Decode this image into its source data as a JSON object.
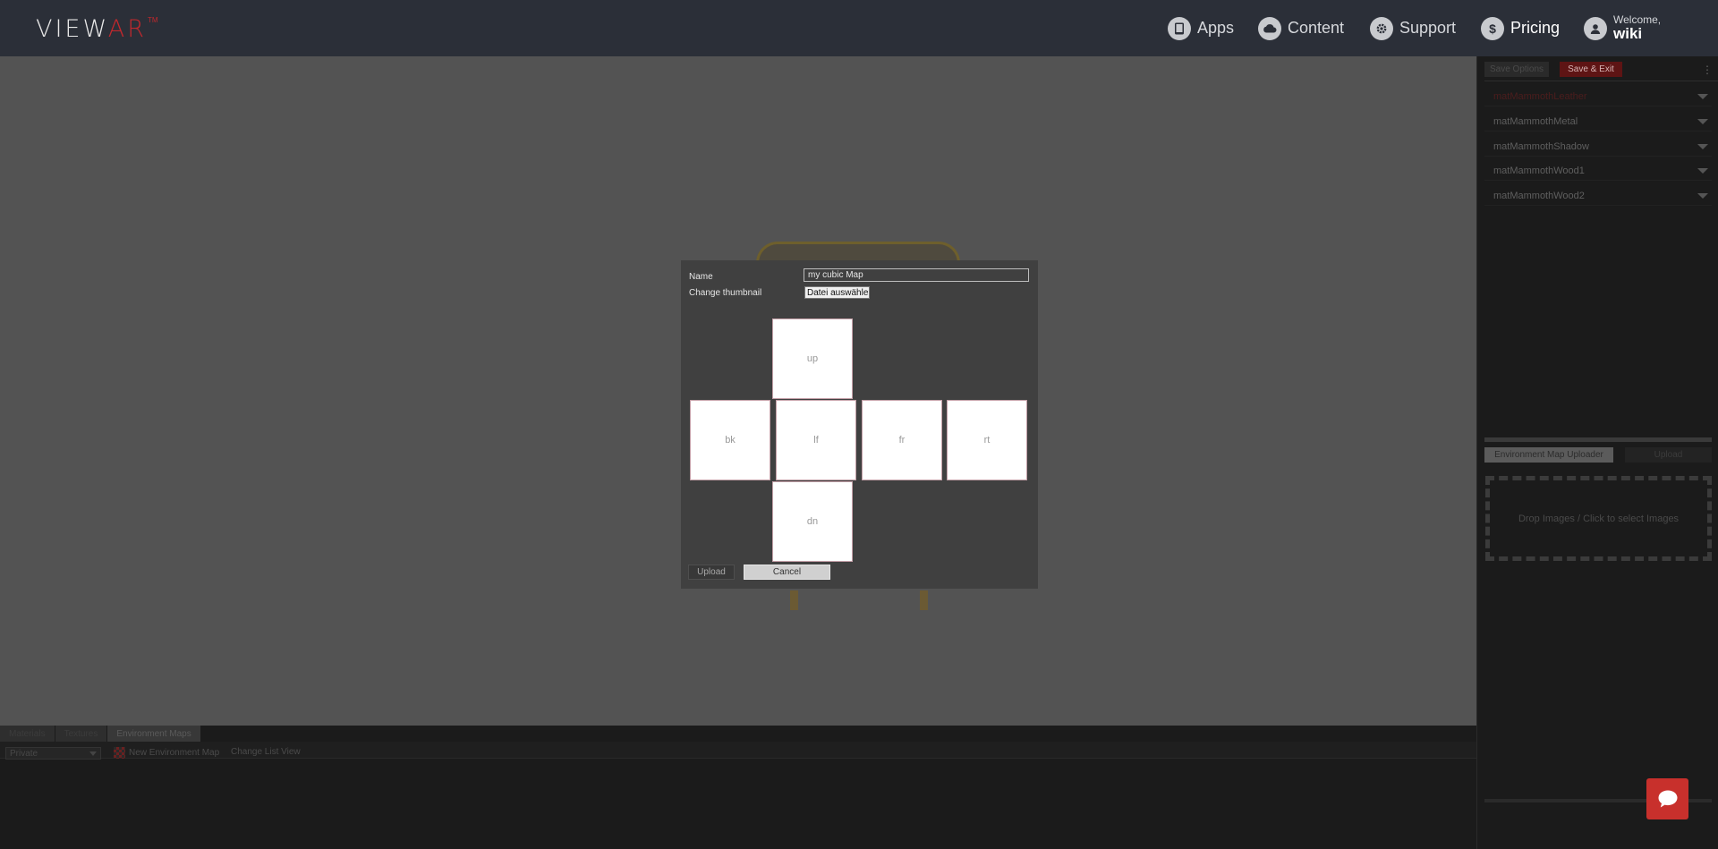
{
  "brand": {
    "logo_part1": "VIEW",
    "logo_part2": "AR",
    "logo_tm": "TM"
  },
  "nav": {
    "apps": "Apps",
    "content": "Content",
    "support": "Support",
    "pricing": "Pricing",
    "pricing_icon": "$",
    "welcome": "Welcome,",
    "user": "wiki"
  },
  "right_panel": {
    "save_options": "Save Options",
    "save_exit": "Save & Exit",
    "more": "⋮",
    "materials": [
      "matMammothLeather",
      "matMammothMetal",
      "matMammothShadow",
      "matMammothWood1",
      "matMammothWood2"
    ],
    "env_uploader_tab": "Environment Map Uploader",
    "upload_tab": "Upload",
    "dropzone": "Drop Images / Click to select Images"
  },
  "bottom_panel": {
    "tabs": [
      "Materials",
      "Textures",
      "Environment Maps"
    ],
    "visibility_select": "Private",
    "new_env_map": "New Environment Map",
    "change_list_view": "Change List View"
  },
  "modal": {
    "name_label": "Name",
    "name_value": "my cubic Map",
    "thumbnail_label": "Change thumbnail",
    "file_button": "Datei auswählen",
    "faces": {
      "up": "up",
      "bk": "bk",
      "lf": "lf",
      "fr": "fr",
      "rt": "rt",
      "dn": "dn"
    },
    "upload": "Upload",
    "cancel": "Cancel"
  },
  "colors": {
    "topbar": "#2b2f38",
    "accent_red": "#c0282d",
    "modal_bg": "#404040",
    "overlay_bg": "#555555"
  }
}
